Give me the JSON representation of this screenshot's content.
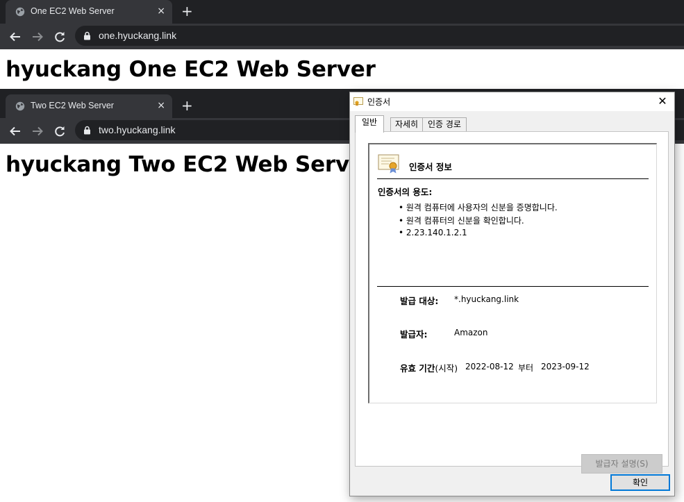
{
  "browser_one": {
    "tab_title": "One EC2 Web Server",
    "url": "one.hyuckang.link",
    "heading": "hyuckang One EC2 Web Server"
  },
  "browser_two": {
    "tab_title": "Two EC2 Web Server",
    "url": "two.hyuckang.link",
    "heading": "hyuckang Two EC2 Web Server"
  },
  "icons": {
    "tab_close": "×",
    "new_tab": "+",
    "dialog_close": "✕"
  },
  "certificate_dialog": {
    "title": "인증서",
    "tabs": [
      "일반",
      "자세히",
      "인증 경로"
    ],
    "active_tab": "일반",
    "info_title": "인증서 정보",
    "purpose_heading": "인증서의 용도:",
    "purposes": [
      "• 원격 컴퓨터에 사용자의 신분을 증명합니다.",
      "• 원격 컴퓨터의 신분을 확인합니다.",
      "• 2.23.140.1.2.1"
    ],
    "issued_to_label": "발급 대상:",
    "issued_to_value": "*.hyuckang.link",
    "issued_by_label": "발급자:",
    "issued_by_value": "Amazon",
    "validity_label": "유효 기간",
    "validity_label_suffix": "(시작)",
    "valid_from": "2022-08-12",
    "valid_word": "부터",
    "valid_to": "2023-09-12",
    "issuer_statement_button": "발급자 설명(S)",
    "ok_button": "확인"
  },
  "colors": {
    "chrome_dark": "#202124",
    "chrome_toolbar": "#35363a",
    "dialog_bg": "#f0f0f0",
    "focus_blue": "#0078d7"
  }
}
